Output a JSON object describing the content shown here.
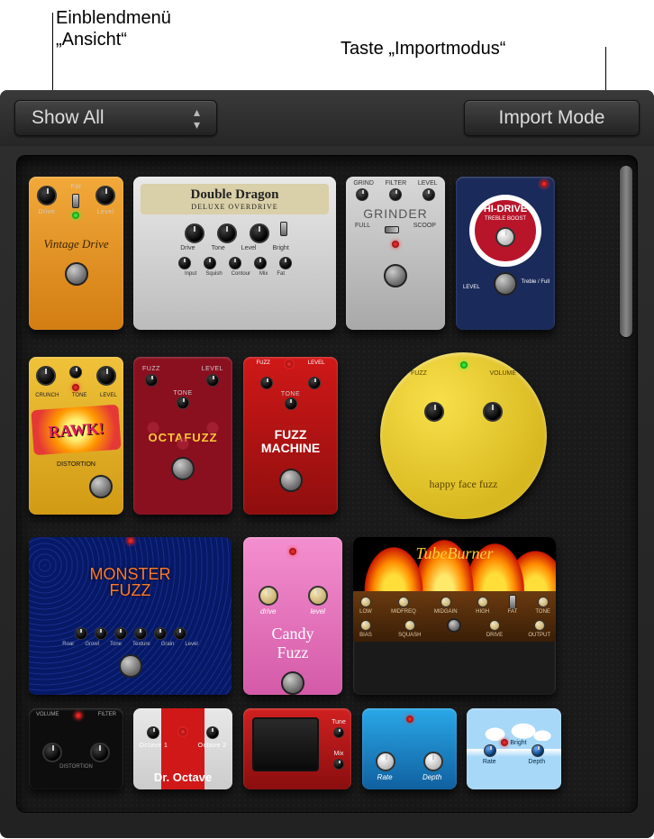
{
  "callouts": {
    "view_menu": "Einblendmenü\n„Ansicht“",
    "view_menu_l1": "Einblendmenü",
    "view_menu_l2": "„Ansicht“",
    "import_button": "Taste „Importmodus“"
  },
  "toolbar": {
    "view_select_label": "Show All",
    "import_button_label": "Import Mode"
  },
  "pedals": {
    "vintage_drive": {
      "name": "Vintage Drive",
      "knob_labels": [
        "Drive",
        "Fat",
        "Level"
      ]
    },
    "double_dragon": {
      "name": "Double Dragon",
      "subtitle": "DELUXE OVERDRIVE",
      "row1": [
        "Drive",
        "Tone",
        "Level"
      ],
      "row1_extra": "Bright",
      "row2": [
        "Input",
        "Squish",
        "Contour",
        "Mix",
        "Fat"
      ]
    },
    "grinder": {
      "name": "GRINDER",
      "top_labels": [
        "GRIND",
        "FILTER",
        "LEVEL"
      ],
      "mode_labels": [
        "FULL",
        "SCOOP"
      ]
    },
    "hidrive": {
      "name": "HI-DRIVE",
      "subtitle": "TREBLE BOOST",
      "level_label": "LEVEL",
      "switch_label": "Treble / Full"
    },
    "rawk": {
      "name": "RAWK!",
      "subtitle": "DISTORTION",
      "knob_labels": [
        "CRUNCH",
        "TONE",
        "LEVEL"
      ]
    },
    "octafuzz": {
      "name": "OCTAFUZZ",
      "knob_labels": [
        "FUZZ",
        "LEVEL",
        "TONE"
      ]
    },
    "fuzz_machine": {
      "name_l1": "FUZZ",
      "name_l2": "MACHINE",
      "top_labels": [
        "FUZZ",
        "LEVEL"
      ],
      "mid_label": "TONE"
    },
    "happy_face": {
      "name": "happy face fuzz",
      "knob_labels": [
        "FUZZ",
        "VOLUME"
      ]
    },
    "monster_fuzz": {
      "name_l1": "MONSTER",
      "name_l2": "FUZZ",
      "knob_labels": [
        "Roar",
        "Growl",
        "Tone",
        "Texture",
        "Grain",
        "Level"
      ]
    },
    "candy_fuzz": {
      "name_l1": "Candy",
      "name_l2": "Fuzz",
      "knob_labels": [
        "drive",
        "level"
      ]
    },
    "tube_burner": {
      "name": "TubeBurner",
      "row1": [
        "LOW",
        "MIDFREQ",
        "MIDGAIN",
        "HIGH",
        "TONE"
      ],
      "row1_fat": "FAT",
      "row2": [
        "BIAS",
        "SQUASH",
        "",
        "DRIVE",
        "OUTPUT"
      ]
    },
    "dark_dist": {
      "labels": [
        "VOLUME",
        "FILTER"
      ],
      "sub": "DISTORTION"
    },
    "dr_octave": {
      "name": "Dr. Octave",
      "knob_labels": [
        "Octave 1",
        "Octave 2"
      ]
    },
    "red_panel": {
      "side_labels": [
        "Tune",
        "Mix"
      ]
    },
    "blue_pedal": {
      "knob_labels": [
        "Rate",
        "Depth"
      ]
    },
    "sky_pedal": {
      "top_label": "Bright",
      "knob_labels": [
        "Rate",
        "Depth"
      ]
    }
  }
}
